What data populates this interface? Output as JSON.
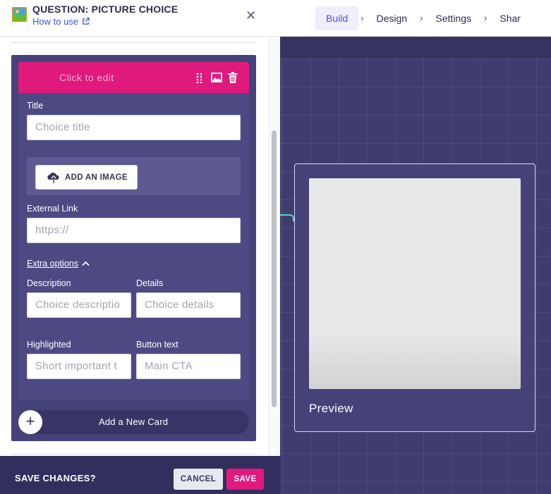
{
  "panel": {
    "title": "QUESTION: PICTURE CHOICE",
    "how_to_use": "How to use",
    "close_glyph": "✕"
  },
  "nav": {
    "tabs": [
      {
        "label": "Build",
        "active": true
      },
      {
        "label": "Design",
        "active": false
      },
      {
        "label": "Settings",
        "active": false
      },
      {
        "label": "Shar",
        "active": false
      }
    ],
    "separator": "›"
  },
  "card": {
    "header_label": "Click to edit",
    "title_label": "Title",
    "title_placeholder": "Choice title",
    "add_image_label": "ADD AN IMAGE",
    "external_link_label": "External Link",
    "external_link_placeholder": "https://",
    "extra_options_label": "Extra options",
    "description_label": "Description",
    "description_placeholder": "Choice descriptio",
    "details_label": "Details",
    "details_placeholder": "Choice details",
    "highlighted_label": "Highlighted",
    "highlighted_placeholder": "Short important t",
    "button_text_label": "Button text",
    "button_text_placeholder": "Main CTA"
  },
  "add_card": {
    "plus_glyph": "+",
    "label": "Add a New Card"
  },
  "savebar": {
    "question": "SAVE CHANGES?",
    "cancel_label": "CANCEL",
    "save_label": "SAVE"
  },
  "preview": {
    "label": "Preview"
  },
  "icons": {
    "question_type": "picture-choice-icon",
    "external": "external-link-icon",
    "drag": "drag-handle-icon",
    "image": "image-icon",
    "delete": "trash-icon",
    "upload": "cloud-upload-icon",
    "chevron": "chevron-up-icon"
  },
  "colors": {
    "accent_pink": "#e0197d",
    "canvas": "#3f3d70",
    "card": "#45427a",
    "link_blue": "#3a56d4",
    "connector_green": "#5fd6a6"
  }
}
